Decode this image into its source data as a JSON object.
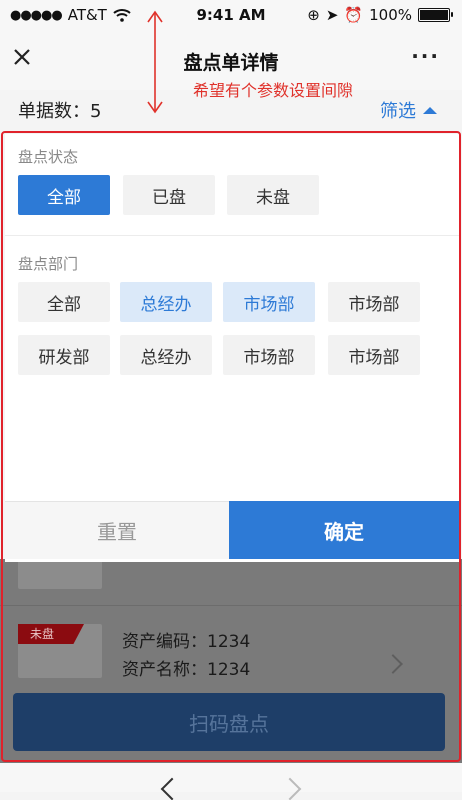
{
  "status_bar": {
    "carrier": "AT&T",
    "time": "9:41 AM",
    "battery_percent": "100%"
  },
  "nav": {
    "title": "盘点单详情",
    "more_label": "···"
  },
  "count_row": {
    "count_text": "单据数：5",
    "filter_label": "筛选"
  },
  "annotation": {
    "text": "希望有个参数设置间隙",
    "color": "#e0322b"
  },
  "filter_panel": {
    "status_label": "盘点状态",
    "status_options": [
      "全部",
      "已盘",
      "未盘"
    ],
    "dept_label": "盘点部门",
    "dept_options": [
      "全部",
      "总经办",
      "市场部",
      "市场部",
      "研发部",
      "总经办",
      "市场部",
      "市场部"
    ],
    "reset_label": "重置",
    "confirm_label": "确定"
  },
  "list": {
    "badge_label": "未盘",
    "asset_code": "资产编码：1234",
    "asset_name": "资产名称：1234",
    "scan_button_label": "扫码盘点"
  },
  "colors": {
    "accent": "#2d7ad6",
    "highlight_outline": "#e0222b",
    "badge": "#8b0b10"
  }
}
